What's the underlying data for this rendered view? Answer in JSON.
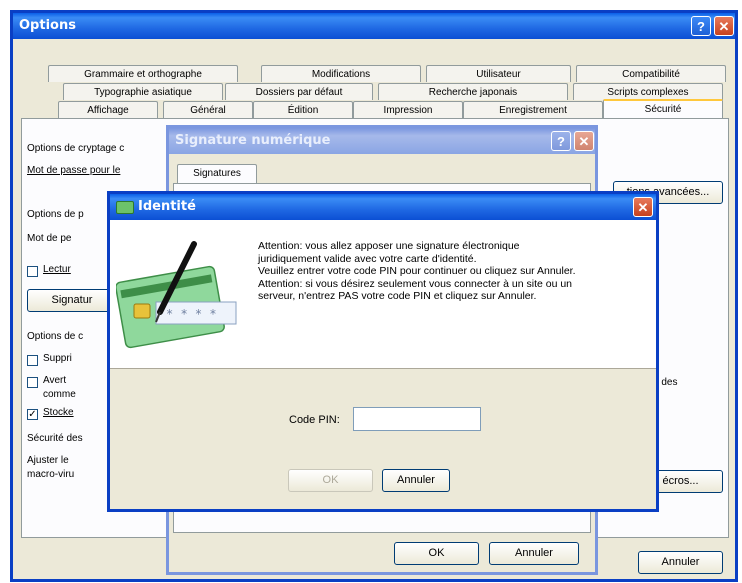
{
  "options": {
    "title": "Options",
    "tabs_row1": [
      "Grammaire et orthographe",
      "Modifications",
      "Utilisateur",
      "Compatibilité"
    ],
    "tabs_row2": [
      "Typographie asiatique",
      "Dossiers par défaut",
      "Recherche japonais",
      "Scripts complexes"
    ],
    "tabs_row3": [
      "Affichage",
      "Général",
      "Édition",
      "Impression",
      "Enregistrement",
      "Sécurité"
    ],
    "labels": {
      "cryptage_section": "Options de cryptage c",
      "password_open": "Mot de passe pour le",
      "partage_section": "Options de p",
      "password_modify": "Mot de pe",
      "readonly": "Lectur",
      "signatures_btn": "Signatur",
      "confid_section": "Options de c",
      "remove_info": "Suppri",
      "warn": "Avert",
      "warn2": "comme",
      "store": "Stocke",
      "macro_section": "Sécurité des",
      "macro_text": "Ajuster le",
      "macro_text2": "macro-viru",
      "advanced_btn": "tions avancées...",
      "right_text": "u des",
      "macros_btn": "écros..."
    },
    "cancel": "Annuler"
  },
  "signature": {
    "title": "Signature numérique",
    "tab": "Signatures",
    "ok": "OK",
    "cancel": "Annuler"
  },
  "identity": {
    "title": "Identité",
    "message": [
      "Attention: vous allez apposer une signature électronique",
      "juridiquement valide avec votre carte d'identité.",
      "Veuillez entrer votre code PIN pour continuer ou cliquez sur Annuler.",
      "Attention: si vous désirez seulement vous connecter à un site ou un",
      "serveur, n'entrez PAS votre code PIN et cliquez sur Annuler."
    ],
    "pin_label": "Code PIN:",
    "pin_value": "",
    "pin_dots": "* * * *",
    "ok": "OK",
    "cancel": "Annuler"
  },
  "colors": {
    "xp_blue": "#0a3fc4",
    "dialog_bg": "#ece9d8",
    "card_green": "#7ccf7a"
  },
  "icons": [
    "help-icon",
    "close-icon",
    "id-card-icon",
    "pen-icon",
    "smart-chip-icon",
    "checkmark-icon"
  ]
}
